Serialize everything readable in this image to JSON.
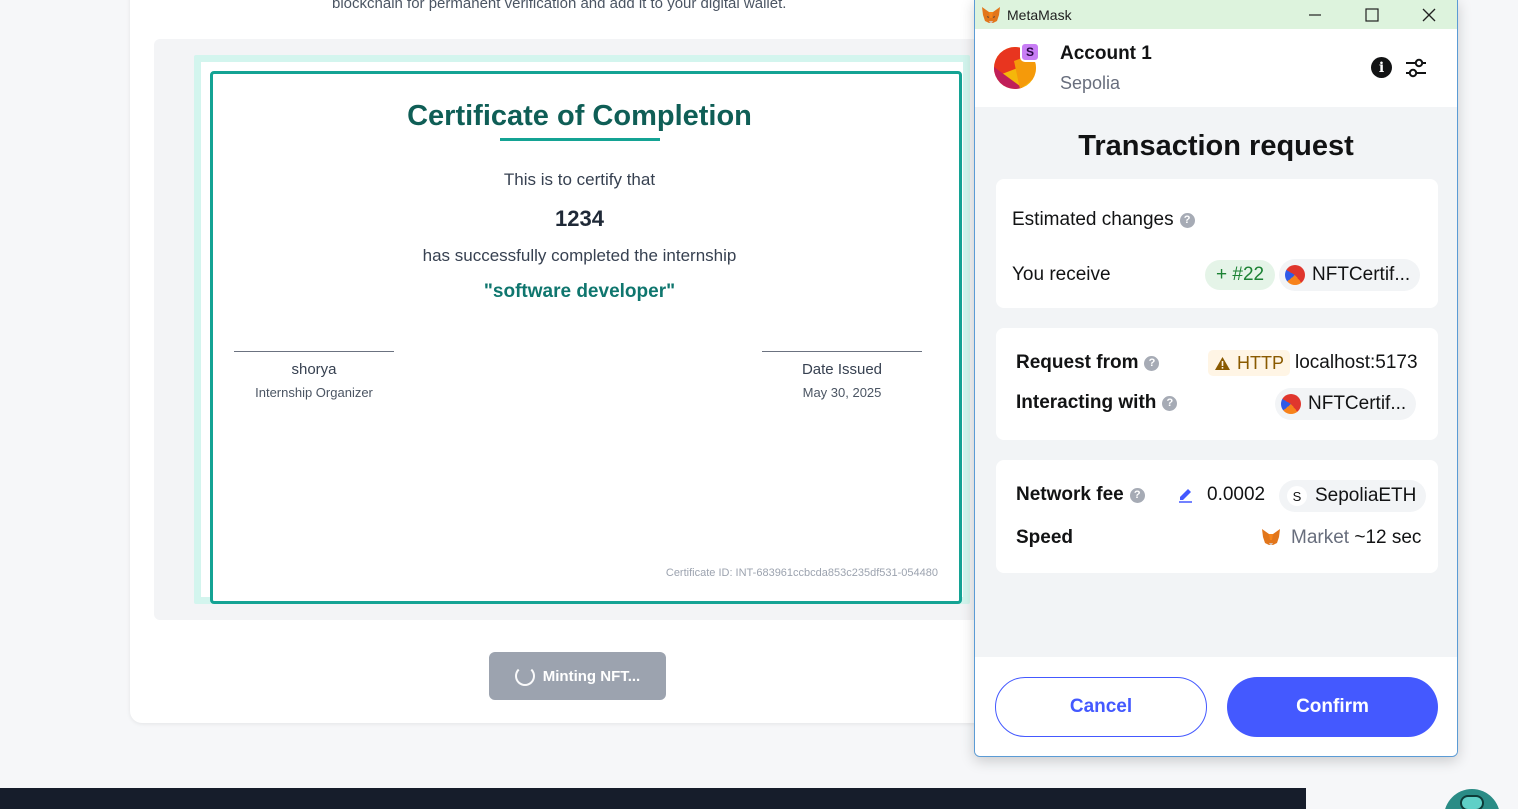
{
  "page": {
    "intro_text": "blockchain for permanent verification and add it to your digital wallet.",
    "mint_button_label": "Minting NFT..."
  },
  "certificate": {
    "title": "Certificate of Completion",
    "certify_text": "This is to certify that",
    "recipient": "1234",
    "completed_text": "has successfully completed the internship",
    "role": "\"software developer\"",
    "signer_name": "shorya",
    "signer_title": "Internship Organizer",
    "date_label": "Date Issued",
    "date_value": "May 30, 2025",
    "certificate_id": "Certificate ID: INT-683961ccbcda853c235df531-054480"
  },
  "metamask": {
    "window_title": "MetaMask",
    "account_name": "Account 1",
    "network_name": "Sepolia",
    "network_badge": "S",
    "title": "Transaction request",
    "estimated_changes": {
      "label": "Estimated changes",
      "row_label": "You receive",
      "amount": "+ #22",
      "token": "NFTCertif..."
    },
    "request": {
      "from_label": "Request from",
      "http_badge": "HTTP",
      "origin": "localhost:5173",
      "interacting_label": "Interacting with",
      "contract": "NFTCertif..."
    },
    "fee": {
      "label": "Network fee",
      "amount": "0.0002",
      "currency_chip": "S",
      "currency": "SepoliaETH",
      "speed_label": "Speed",
      "speed_mode": "Market",
      "speed_time": "~12 sec"
    },
    "buttons": {
      "cancel": "Cancel",
      "confirm": "Confirm"
    },
    "colors": {
      "accent": "#4459ff",
      "titlebar": "#ddf3dd",
      "success": "#1c8234"
    }
  },
  "icons": {
    "fox": "metamask-fox-icon",
    "info": "info-icon",
    "settings": "sliders-icon",
    "help": "question-icon",
    "warning": "warning-icon",
    "edit": "pencil-icon",
    "spinner": "spinner-icon"
  }
}
